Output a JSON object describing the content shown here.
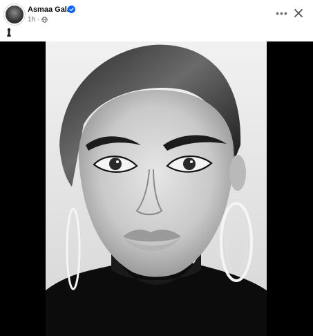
{
  "post": {
    "author_name": "Asmaa Galal",
    "timestamp": "1h",
    "separator": "·",
    "verified": true,
    "privacy_icon": "globe-icon",
    "caption_icon": "pawn-emoji"
  },
  "header_actions": {
    "more_icon": "more-options-icon",
    "more_label": "•••",
    "close_icon": "close-icon"
  },
  "photo": {
    "type": "black-and-white portrait photo",
    "background_color": "#000000"
  },
  "colors": {
    "name": "#050505",
    "meta": "#65676b",
    "verified_badge": "#0866ff"
  }
}
